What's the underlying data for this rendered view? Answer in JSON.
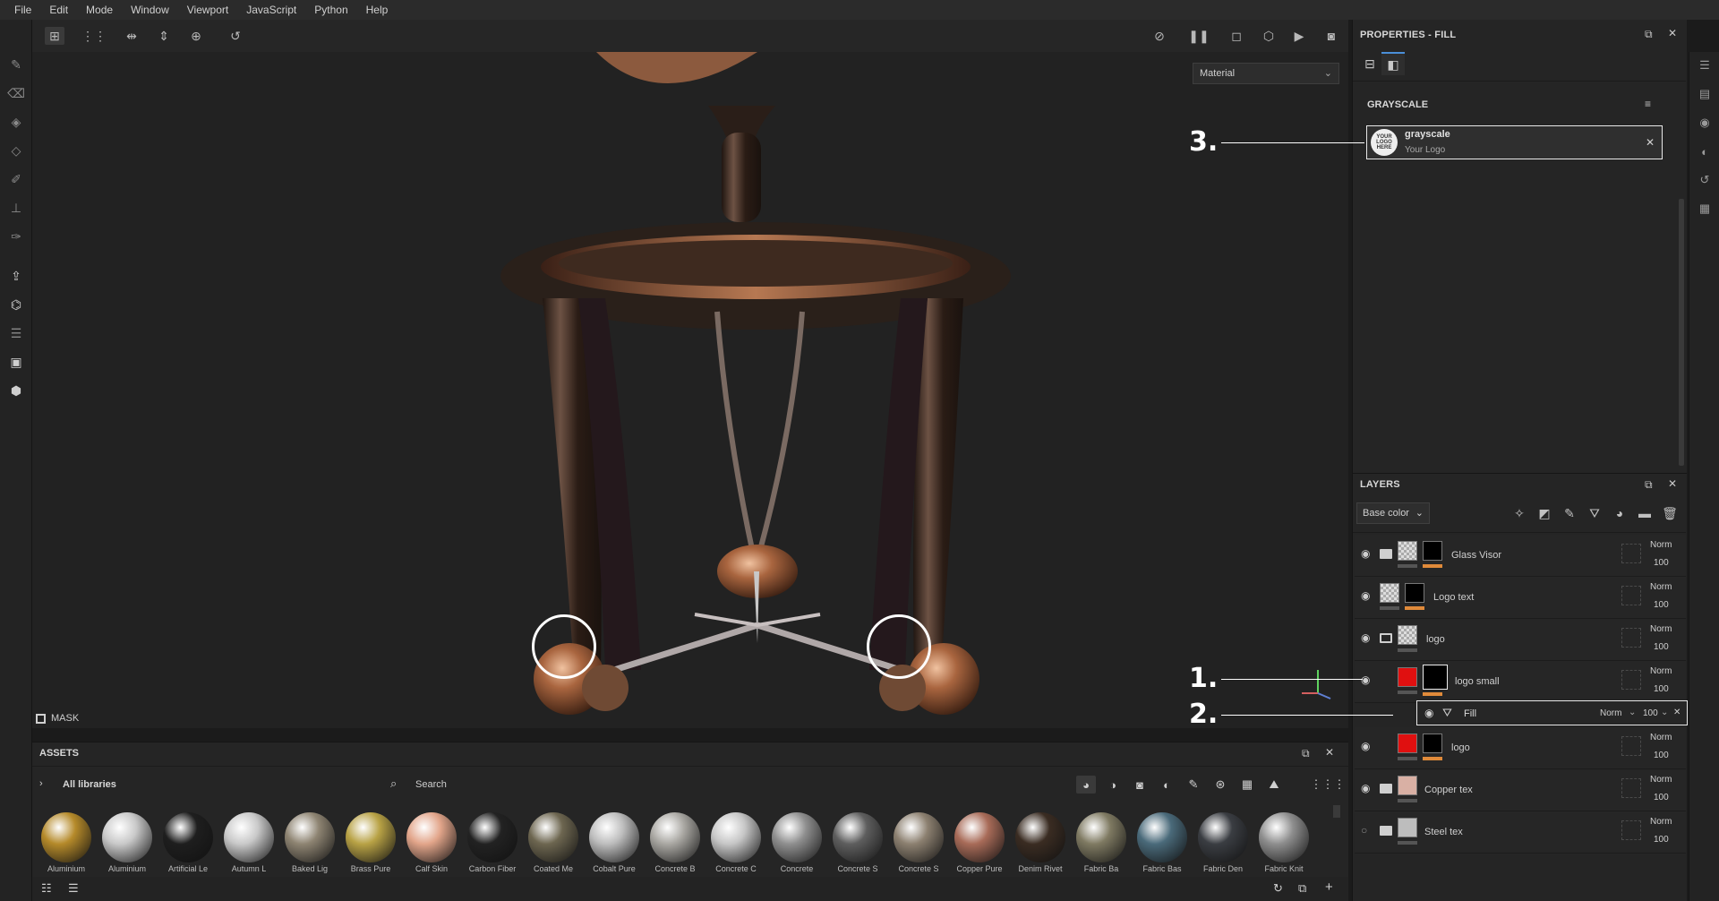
{
  "menu": [
    "File",
    "Edit",
    "Mode",
    "Window",
    "Viewport",
    "JavaScript",
    "Python",
    "Help"
  ],
  "viewport": {
    "material_select": "Material",
    "mask_label": "MASK"
  },
  "annotations": [
    "1.",
    "2.",
    "3."
  ],
  "properties": {
    "title": "PROPERTIES - FILL",
    "section": "GRAYSCALE",
    "resource_name": "grayscale",
    "resource_sub": "Your Logo",
    "thumb_text": "YOUR LOGO HERE"
  },
  "layers": {
    "title": "LAYERS",
    "channel": "Base color",
    "rows": [
      {
        "name": "Glass Visor",
        "blend": "Norm",
        "opacity": "100"
      },
      {
        "name": "Logo text",
        "blend": "Norm",
        "opacity": "100"
      },
      {
        "name": "logo",
        "blend": "Norm",
        "opacity": "100"
      },
      {
        "name": "logo small",
        "blend": "Norm",
        "opacity": "100"
      },
      {
        "name": "logo",
        "blend": "Norm",
        "opacity": "100"
      },
      {
        "name": "Copper tex",
        "blend": "Norm",
        "opacity": "100"
      },
      {
        "name": "Steel tex",
        "blend": "Norm",
        "opacity": "100"
      }
    ],
    "fill": {
      "name": "Fill",
      "blend": "Norm",
      "opacity": "100"
    }
  },
  "assets": {
    "title": "ASSETS",
    "library": "All libraries",
    "search_placeholder": "Search",
    "items": [
      {
        "label": "Aluminium",
        "color": "#b58a2a"
      },
      {
        "label": "Aluminium",
        "color": "#c9c9c9"
      },
      {
        "label": "Artificial Le",
        "color": "#1e1e1e"
      },
      {
        "label": "Autumn L",
        "color": "#c9c9c9"
      },
      {
        "label": "Baked Lig",
        "color": "#8e8472"
      },
      {
        "label": "Brass Pure",
        "color": "#b8a245"
      },
      {
        "label": "Calf Skin",
        "color": "#e2a58a"
      },
      {
        "label": "Carbon Fiber",
        "color": "#222222"
      },
      {
        "label": "Coated Me",
        "color": "#6d6650"
      },
      {
        "label": "Cobalt Pure",
        "color": "#bdbdbd"
      },
      {
        "label": "Concrete B",
        "color": "#a9a7a2"
      },
      {
        "label": "Concrete C",
        "color": "#c6c6c6"
      },
      {
        "label": "Concrete",
        "color": "#8f8f8f"
      },
      {
        "label": "Concrete S",
        "color": "#5e5e5e"
      },
      {
        "label": "Concrete S",
        "color": "#8c8070"
      },
      {
        "label": "Copper Pure",
        "color": "#a86b58"
      },
      {
        "label": "Denim Rivet",
        "color": "#3a2c22"
      },
      {
        "label": "Fabric Ba",
        "color": "#7f7a62"
      },
      {
        "label": "Fabric Bas",
        "color": "#4a6a7a"
      },
      {
        "label": "Fabric Den",
        "color": "#3a3d42"
      },
      {
        "label": "Fabric Knit",
        "color": "#8e8e8e"
      }
    ]
  },
  "colors": {
    "accent_orange": "#e08a3a",
    "logo_red": "#e01010",
    "annotation": "#ffffff"
  }
}
